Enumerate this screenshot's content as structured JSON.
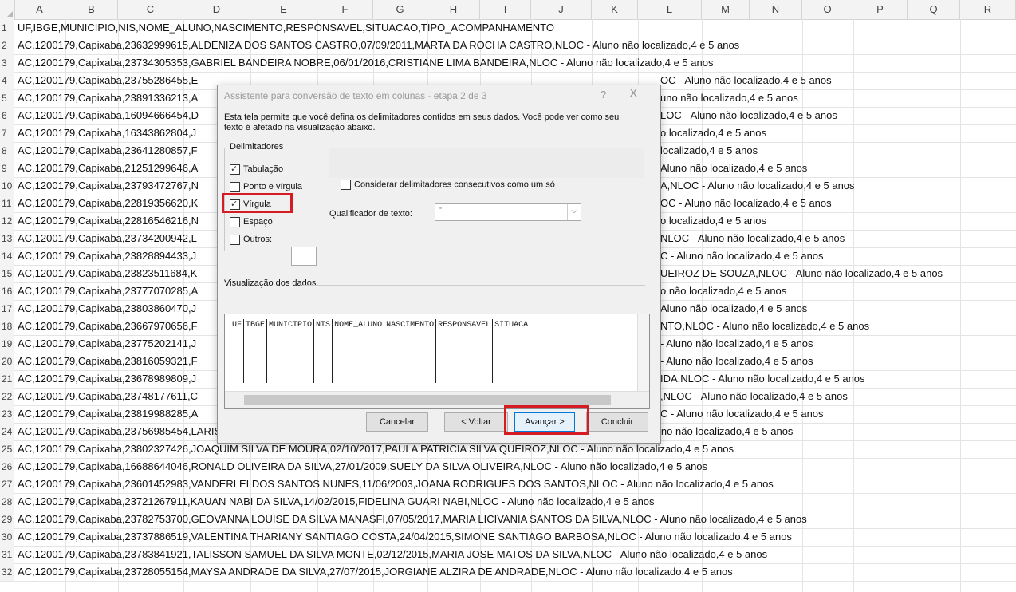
{
  "columns": [
    "A",
    "B",
    "C",
    "D",
    "E",
    "F",
    "G",
    "H",
    "I",
    "J",
    "K",
    "L",
    "M",
    "N",
    "O",
    "P",
    "Q",
    "R"
  ],
  "rows": [
    {
      "n": "1",
      "text": "UF,IBGE,MUNICIPIO,NIS,NOME_ALUNO,NASCIMENTO,RESPONSAVEL,SITUACAO,TIPO_ACOMPANHAMENTO"
    },
    {
      "n": "2",
      "text": "AC,1200179,Capixaba,23632999615,ALDENIZA DOS SANTOS CASTRO,07/09/2011,MARTA DA ROCHA CASTRO,NLOC - Aluno não localizado,4 e 5 anos"
    },
    {
      "n": "3",
      "text": "AC,1200179,Capixaba,23734305353,GABRIEL BANDEIRA NOBRE,06/01/2016,CRISTIANE LIMA BANDEIRA,NLOC - Aluno não localizado,4 e 5 anos"
    },
    {
      "n": "4",
      "text": "AC,1200179,Capixaba,23755286455,E",
      "tail": "OC - Aluno não localizado,4 e 5 anos"
    },
    {
      "n": "5",
      "text": "AC,1200179,Capixaba,23891336213,A",
      "tail": "uno não localizado,4 e 5 anos"
    },
    {
      "n": "6",
      "text": "AC,1200179,Capixaba,16094666454,D",
      "tail": "LOC - Aluno não localizado,4 e 5 anos"
    },
    {
      "n": "7",
      "text": "AC,1200179,Capixaba,16343862804,J",
      "tail": "o localizado,4 e 5 anos"
    },
    {
      "n": "8",
      "text": "AC,1200179,Capixaba,23641280857,F",
      "tail": "localizado,4 e 5 anos"
    },
    {
      "n": "9",
      "text": "AC,1200179,Capixaba,21251299646,A",
      "tail": "Aluno não localizado,4 e 5 anos"
    },
    {
      "n": "10",
      "text": "AC,1200179,Capixaba,23793472767,N",
      "tail": "A,NLOC - Aluno não localizado,4 e 5 anos"
    },
    {
      "n": "11",
      "text": "AC,1200179,Capixaba,22819356620,K",
      "tail": "OC - Aluno não localizado,4 e 5 anos"
    },
    {
      "n": "12",
      "text": "AC,1200179,Capixaba,22816546216,N",
      "tail": "o localizado,4 e 5 anos"
    },
    {
      "n": "13",
      "text": "AC,1200179,Capixaba,23734200942,L",
      "tail": "NLOC - Aluno não localizado,4 e 5 anos"
    },
    {
      "n": "14",
      "text": "AC,1200179,Capixaba,23828894433,J",
      "tail": "C - Aluno não localizado,4 e 5 anos"
    },
    {
      "n": "15",
      "text": "AC,1200179,Capixaba,23823511684,K",
      "tail": "UEIROZ DE SOUZA,NLOC - Aluno não localizado,4 e 5 anos"
    },
    {
      "n": "16",
      "text": "AC,1200179,Capixaba,23777070285,A",
      "tail": "o não localizado,4 e 5 anos"
    },
    {
      "n": "17",
      "text": "AC,1200179,Capixaba,23803860470,J",
      "tail": "Aluno não localizado,4 e 5 anos"
    },
    {
      "n": "18",
      "text": "AC,1200179,Capixaba,23667970656,F",
      "tail": "NTO,NLOC - Aluno não localizado,4 e 5 anos"
    },
    {
      "n": "19",
      "text": "AC,1200179,Capixaba,23775202141,J",
      "tail": "- Aluno não localizado,4 e 5 anos"
    },
    {
      "n": "20",
      "text": "AC,1200179,Capixaba,23816059321,F",
      "tail": "- Aluno não localizado,4 e 5 anos"
    },
    {
      "n": "21",
      "text": "AC,1200179,Capixaba,23678989809,J",
      "tail": "IDA,NLOC - Aluno não localizado,4 e 5 anos"
    },
    {
      "n": "22",
      "text": "AC,1200179,Capixaba,23748177611,C",
      "tail": ",NLOC - Aluno não localizado,4 e 5 anos"
    },
    {
      "n": "23",
      "text": "AC,1200179,Capixaba,23819988285,A",
      "tail": "C - Aluno não localizado,4 e 5 anos"
    },
    {
      "n": "24",
      "text": "AC,1200179,Capixaba,23756985454,LARISSA MANOELA COSTA DA SILVA,13/04/2016,MARIA ALBERTINA COSTA DA SILVA,NLOC - Aluno não localizado,4 e 5 anos"
    },
    {
      "n": "25",
      "text": "AC,1200179,Capixaba,23802327426,JOAQUIM SILVA DE MOURA,02/10/2017,PAULA PATRICIA SILVA QUEIROZ,NLOC - Aluno não localizado,4 e 5 anos"
    },
    {
      "n": "26",
      "text": "AC,1200179,Capixaba,16688644046,RONALD OLIVEIRA DA SILVA,27/01/2009,SUELY DA SILVA OLIVEIRA,NLOC - Aluno não localizado,4 e 5 anos"
    },
    {
      "n": "27",
      "text": "AC,1200179,Capixaba,23601452983,VANDERLEI DOS SANTOS NUNES,11/06/2003,JOANA RODRIGUES DOS SANTOS,NLOC - Aluno não localizado,4 e 5 anos"
    },
    {
      "n": "28",
      "text": "AC,1200179,Capixaba,23721267911,KAUAN NABI DA SILVA,14/02/2015,FIDELINA GUARI NABI,NLOC - Aluno não localizado,4 e 5 anos"
    },
    {
      "n": "29",
      "text": "AC,1200179,Capixaba,23782753700,GEOVANNA LOUISE DA SILVA MANASFI,07/05/2017,MARIA LICIVANIA SANTOS DA SILVA,NLOC - Aluno não localizado,4 e 5 anos"
    },
    {
      "n": "30",
      "text": "AC,1200179,Capixaba,23737886519,VALENTINA THARIANY SANTIAGO COSTA,24/04/2015,SIMONE SANTIAGO BARBOSA,NLOC - Aluno não localizado,4 e 5 anos"
    },
    {
      "n": "31",
      "text": "AC,1200179,Capixaba,23783841921,TALISSON SAMUEL DA SILVA MONTE,02/12/2015,MARIA JOSE MATOS DA SILVA,NLOC - Aluno não localizado,4 e 5 anos"
    },
    {
      "n": "32",
      "text": "AC,1200179,Capixaba,23728055154,MAYSA ANDRADE DA SILVA,27/07/2015,JORGIANE ALZIRA DE ANDRADE,NLOC - Aluno não localizado,4 e 5 anos"
    }
  ],
  "dialog": {
    "title": "Assistente para conversão de texto em colunas - etapa 2 de 3",
    "help": "?",
    "close": "X",
    "description": "Esta tela permite que você defina os delimitadores contidos em seus dados. Você pode ver como seu texto é afetado na visualização abaixo.",
    "delimiters_label": "Delimitadores",
    "tab_label": "Tabulação",
    "semicolon_label": "Ponto e vírgula",
    "comma_label": "Vírgula",
    "space_label": "Espaço",
    "other_label": "Outros:",
    "consecutive_label": "Considerar delimitadores consecutivos como um só",
    "text_qualifier_label": "Qualificador de texto:",
    "text_qualifier_value": "\"",
    "preview_label": "Visualização dos dados",
    "preview_columns": [
      "UF",
      "IBGE",
      "MUNICIPIO",
      "NIS",
      "NOME_ALUNO",
      "NASCIMENTO",
      "RESPONSAVEL",
      "SITUACA"
    ],
    "cancel": "Cancelar",
    "back": "< Voltar",
    "next": "Avançar >",
    "finish": "Concluir"
  }
}
